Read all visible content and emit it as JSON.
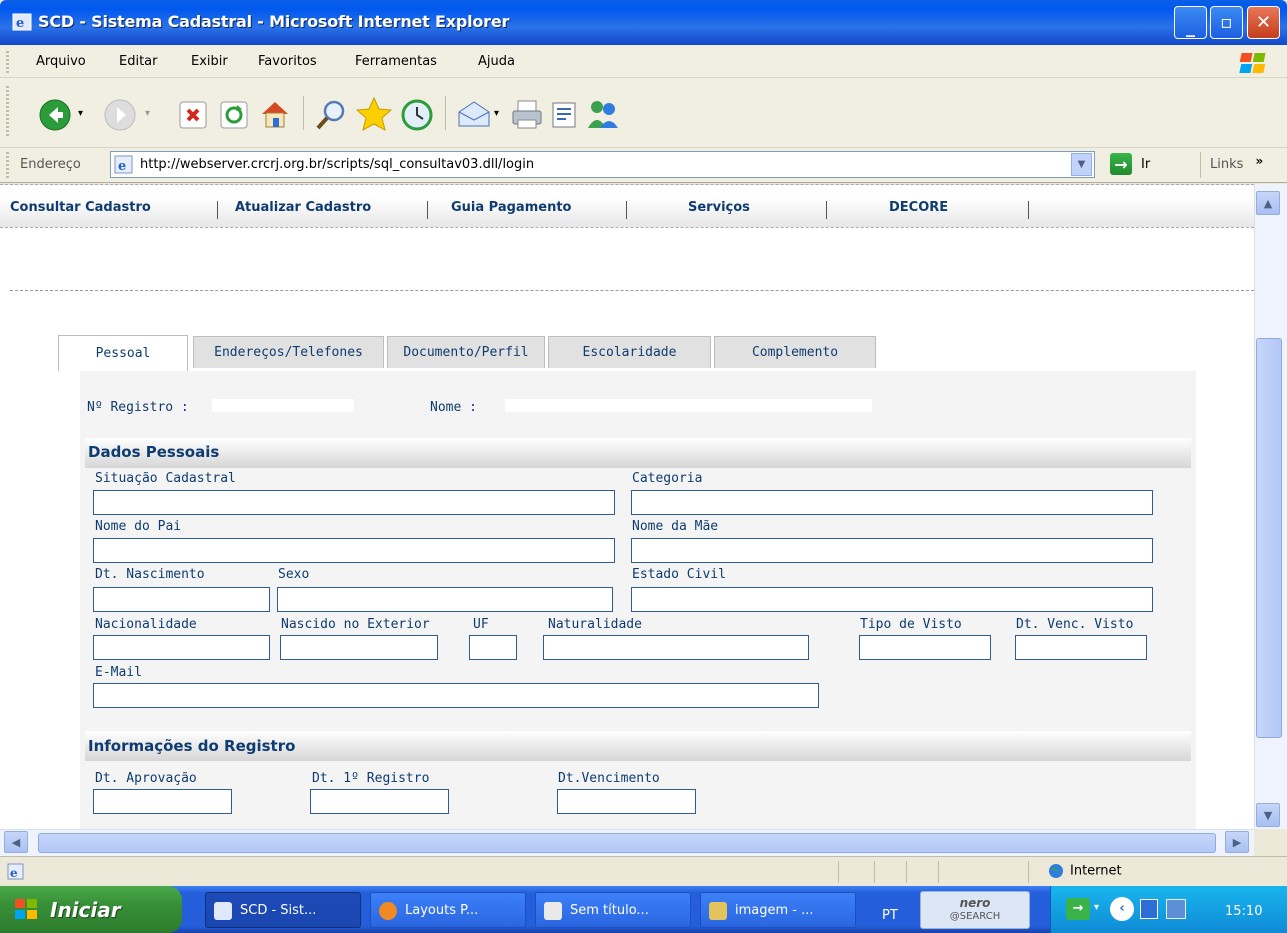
{
  "window": {
    "title": "SCD - Sistema Cadastral - Microsoft Internet Explorer"
  },
  "menu": [
    "Arquivo",
    "Editar",
    "Exibir",
    "Favoritos",
    "Ferramentas",
    "Ajuda"
  ],
  "address": {
    "label": "Endereço",
    "url": "http://webserver.crcrj.org.br/scripts/sql_consultav03.dll/login",
    "go": "Ir",
    "links": "Links",
    "more": "»"
  },
  "nav": [
    "Consultar Cadastro",
    "Atualizar Cadastro",
    "Guia Pagamento",
    "Serviços",
    "DECORE"
  ],
  "tabs": [
    "Pessoal",
    "Endereços/Telefones",
    "Documento/Perfil",
    "Escolaridade",
    "Complemento"
  ],
  "header": {
    "registro": "Nº Registro :",
    "nome": "Nome :"
  },
  "dados": {
    "title": "Dados Pessoais",
    "situacao": "Situação Cadastral",
    "categoria": "Categoria",
    "pai": "Nome do Pai",
    "mae": "Nome da Mãe",
    "nasc": "Dt. Nascimento",
    "sexo": "Sexo",
    "civil": "Estado Civil",
    "nacionalidade": "Nacionalidade",
    "exterior": "Nascido no Exterior",
    "uf": "UF",
    "naturalidade": "Naturalidade",
    "visto": "Tipo de Visto",
    "venc_visto": "Dt. Venc. Visto",
    "email": "E-Mail"
  },
  "registro": {
    "title": "Informações do Registro",
    "aprovacao": "Dt. Aprovação",
    "primeiro": "Dt. 1º Registro",
    "vencimento": "Dt.Vencimento"
  },
  "status": {
    "zone": "Internet"
  },
  "taskbar": {
    "start": "Iniciar",
    "tasks": [
      "SCD - Sist...",
      "Layouts P...",
      "Sem título...",
      "imagem - ..."
    ],
    "lang": "PT",
    "nero": "nero",
    "nero_sub": "@SEARCH",
    "clock": "15:10"
  }
}
